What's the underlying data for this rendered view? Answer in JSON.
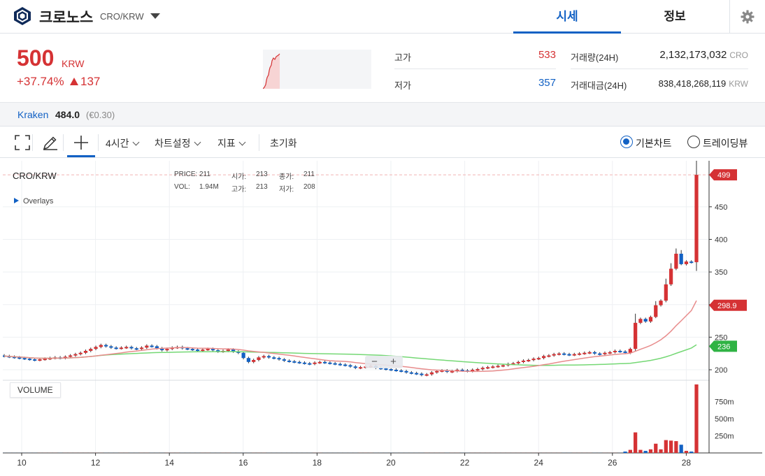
{
  "header": {
    "coin_name": "크로노스",
    "pair": "CRO/KRW",
    "tabs": [
      "시세",
      "정보"
    ],
    "active_tab": "시세",
    "accent": "#1261c4"
  },
  "price": {
    "current": "500",
    "unit": "KRW",
    "change_pct": "+37.74%",
    "change_abs": "137",
    "color": "#d53234"
  },
  "stats": {
    "high": {
      "label": "고가",
      "value": "533"
    },
    "low": {
      "label": "저가",
      "value": "357"
    },
    "volume": {
      "label": "거래량(24H)",
      "value": "2,132,173,032",
      "unit": "CRO"
    },
    "amount": {
      "label": "거래대금(24H)",
      "value": "838,418,268,119",
      "unit": "KRW"
    }
  },
  "exchange": {
    "name": "Kraken",
    "price": "484.0",
    "eur": "(€0.30)"
  },
  "toolbar": {
    "interval": "4시간",
    "chart_settings": "차트설정",
    "indicators": "지표",
    "reset": "초기화",
    "radio_basic": "기본차트",
    "radio_trading": "트레이딩뷰",
    "selected_radio": "기본차트"
  },
  "chart": {
    "pair_label": "CRO/KRW",
    "overlays_label": "Overlays",
    "volume_label": "VOLUME",
    "ohlc": {
      "price_label": "PRICE:",
      "price": "211",
      "open_label": "시가:",
      "open": "213",
      "close_label": "종가:",
      "close": "211",
      "vol_label": "VOL:",
      "vol": "1.94M",
      "high_label": "고가:",
      "high": "213",
      "low_label": "저가:",
      "low": "208"
    },
    "zoom_minus": "−",
    "zoom_plus": "+"
  },
  "chart_data": {
    "type": "candlestick",
    "x_ticks": [
      "10",
      "12",
      "14",
      "16",
      "18",
      "20",
      "22",
      "24",
      "26",
      "28"
    ],
    "y_ticks": [
      200,
      250,
      300,
      350,
      400,
      450
    ],
    "ylim": [
      185,
      512
    ],
    "volume_ticks": [
      "250m",
      "500m",
      "750m"
    ],
    "volume_ylim": [
      0,
      1000
    ],
    "price_tags": [
      {
        "value": "499",
        "color": "#d53234"
      },
      {
        "value": "298.9",
        "color": "#d53234"
      },
      {
        "value": "236",
        "color": "#2fb344"
      }
    ],
    "candles_close": [
      221,
      220,
      219,
      218,
      217,
      216,
      215,
      216,
      217,
      218,
      219,
      218,
      220,
      222,
      224,
      226,
      229,
      232,
      235,
      238,
      236,
      234,
      233,
      234,
      235,
      233,
      232,
      234,
      237,
      236,
      233,
      230,
      232,
      234,
      235,
      233,
      232,
      231,
      229,
      231,
      232,
      230,
      228,
      229,
      231,
      228,
      226,
      218,
      212,
      215,
      219,
      221,
      219,
      218,
      216,
      214,
      213,
      212,
      211,
      210,
      209,
      211,
      212,
      211,
      210,
      209,
      208,
      207,
      205,
      203,
      204,
      205,
      206,
      203,
      202,
      201,
      200,
      199,
      198,
      196,
      195,
      194,
      192,
      193,
      196,
      198,
      199,
      197,
      198,
      200,
      199,
      198,
      200,
      201,
      203,
      204,
      205,
      206,
      207,
      209,
      210,
      212,
      214,
      215,
      217,
      218,
      221,
      222,
      224,
      225,
      224,
      223,
      224,
      225,
      226,
      227,
      225,
      224,
      226,
      227,
      229,
      228,
      226,
      232,
      272,
      278,
      274,
      281,
      299,
      306,
      331,
      355,
      378,
      362,
      366,
      365,
      499
    ]
  },
  "colors": {
    "up": "#d53234",
    "down": "#1261c4",
    "ma_slow": "#75d875",
    "ma_fast": "#e88c8c"
  }
}
